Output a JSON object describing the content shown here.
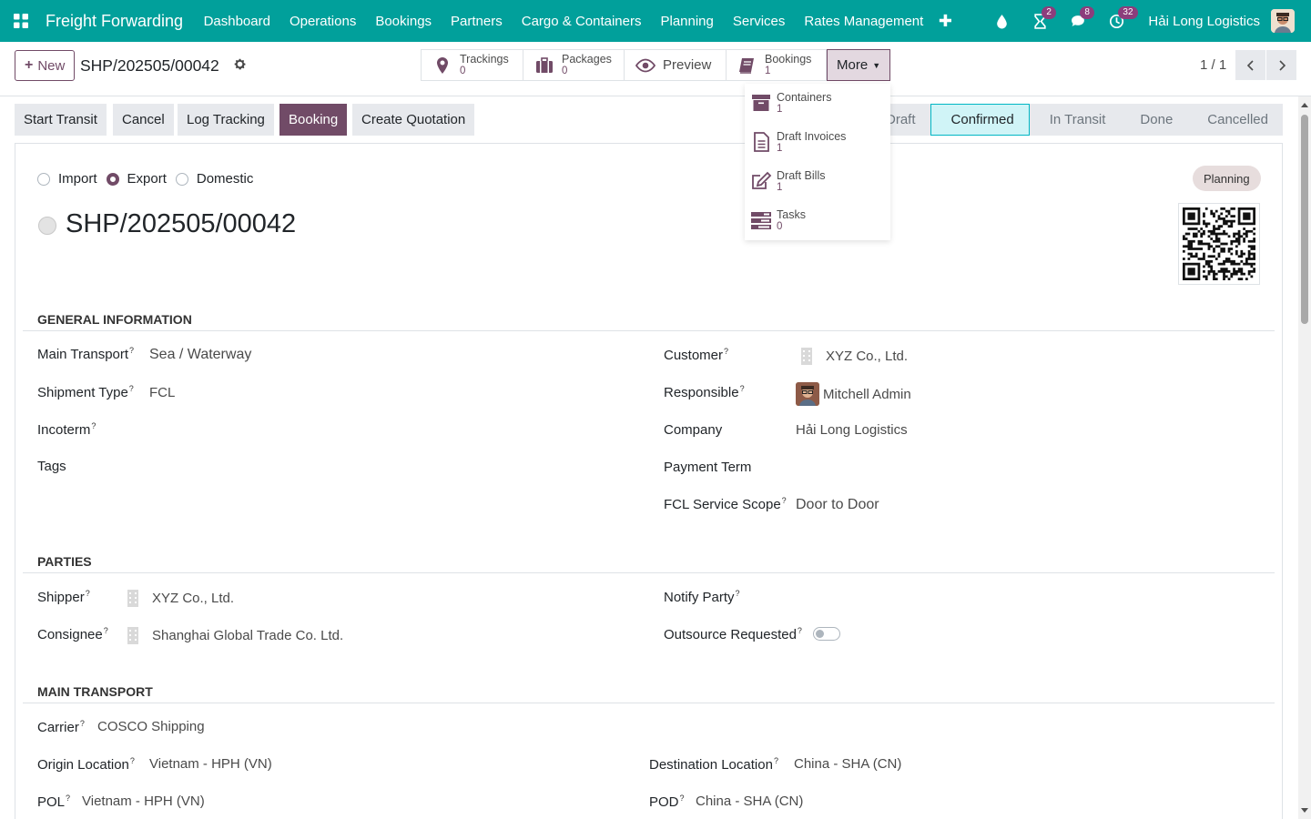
{
  "navbar": {
    "app_name": "Freight Forwarding",
    "menu": [
      "Dashboard",
      "Operations",
      "Bookings",
      "Partners",
      "Cargo & Containers",
      "Planning",
      "Services",
      "Rates Management"
    ],
    "badges": {
      "activities": "2",
      "messages": "8",
      "timer": "32"
    },
    "company": "Hải Long Logistics",
    "brand_color": "#01a09b"
  },
  "control": {
    "new_label": "New",
    "record_ref": "SHP/202505/00042",
    "smart_buttons": [
      {
        "label": "Trackings",
        "count": "0",
        "icon": "map-marker-icon"
      },
      {
        "label": "Packages",
        "count": "0",
        "icon": "briefcase-icon"
      },
      {
        "label": "Preview",
        "icon": "eye-icon"
      },
      {
        "label": "Bookings",
        "count": "1",
        "icon": "book-icon"
      }
    ],
    "more_label": "More",
    "pager": "1 / 1"
  },
  "more_dropdown": [
    {
      "label": "Containers",
      "count": "1",
      "icon": "archive-icon"
    },
    {
      "label": "Draft Invoices",
      "count": "1",
      "icon": "file-text-icon"
    },
    {
      "label": "Draft Bills",
      "count": "1",
      "icon": "edit-icon"
    },
    {
      "label": "Tasks",
      "count": "0",
      "icon": "tasks-icon"
    }
  ],
  "actions": [
    "Start Transit",
    "Cancel",
    "Log Tracking",
    "Booking",
    "Create Quotation"
  ],
  "statuses": [
    "Draft",
    "Confirmed",
    "In Transit",
    "Done",
    "Cancelled"
  ],
  "active_status": "Confirmed",
  "direction": {
    "options": [
      "Import",
      "Export",
      "Domestic"
    ],
    "selected": "Export"
  },
  "stage_badge": "Planning",
  "title": "SHP/202505/00042",
  "general": {
    "section": "General Information",
    "main_transport_label": "Main Transport",
    "main_transport": "Sea / Waterway",
    "shipment_type_label": "Shipment Type",
    "shipment_type": "FCL",
    "incoterm_label": "Incoterm",
    "tags_label": "Tags",
    "customer_label": "Customer",
    "customer": "XYZ Co., Ltd.",
    "responsible_label": "Responsible",
    "responsible": "Mitchell Admin",
    "company_label": "Company",
    "company": "Hải Long Logistics",
    "payment_term_label": "Payment Term",
    "fcl_scope_label": "FCL Service Scope",
    "fcl_scope": "Door to Door"
  },
  "parties": {
    "section": "Parties",
    "shipper_label": "Shipper",
    "shipper": "XYZ Co., Ltd.",
    "consignee_label": "Consignee",
    "consignee": "Shanghai Global Trade Co. Ltd.",
    "notify_label": "Notify Party",
    "outsource_label": "Outsource Requested",
    "outsource": false
  },
  "main_transport": {
    "section": "Main Transport",
    "carrier_label": "Carrier",
    "carrier": "COSCO Shipping",
    "origin_label": "Origin Location",
    "origin": "Vietnam - HPH (VN)",
    "destination_label": "Destination Location",
    "destination": "China - SHA (CN)",
    "pol_label": "POL",
    "pol": "Vietnam - HPH (VN)",
    "pod_label": "POD",
    "pod": "China - SHA (CN)"
  }
}
